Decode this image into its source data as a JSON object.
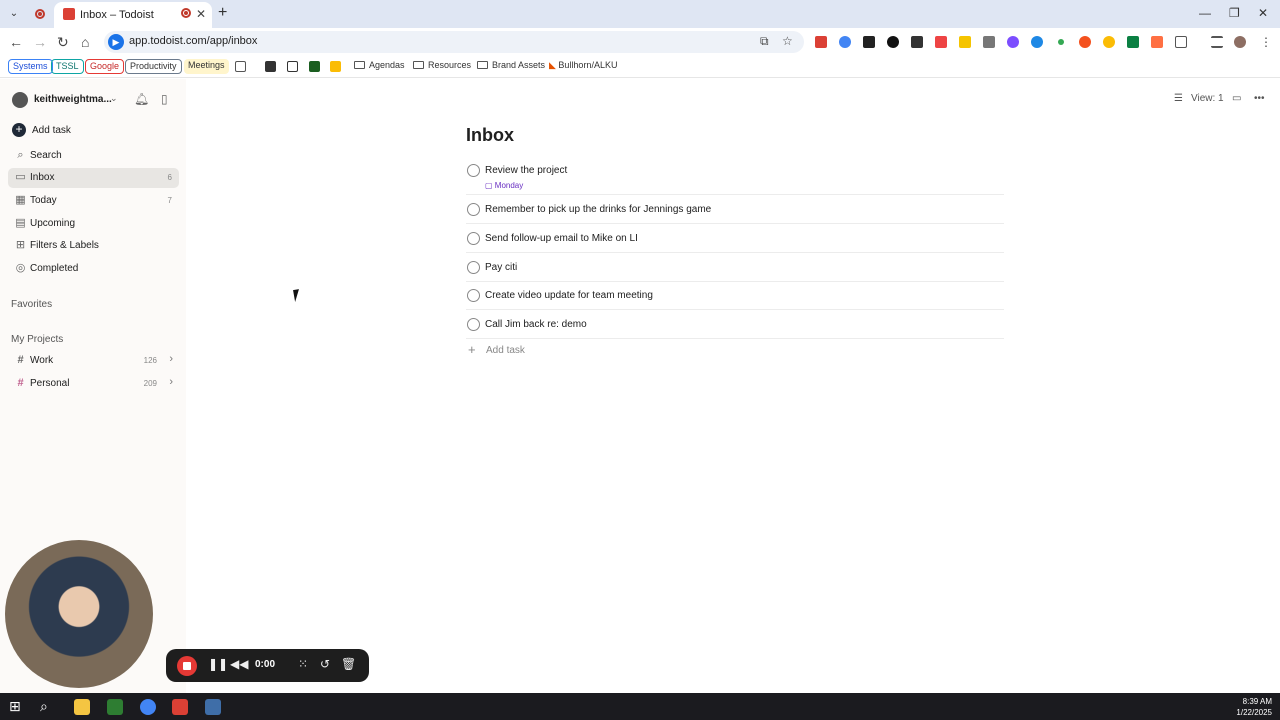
{
  "browser": {
    "tab_title": "Inbox – Todoist",
    "url": "app.todoist.com/app/inbox",
    "bookmarks": [
      "Systems",
      "TSSL",
      "Google",
      "Productivity",
      "Meetings",
      "Agendas",
      "Resources",
      "Brand Assets",
      "Bullhorn/ALKU"
    ]
  },
  "sidebar": {
    "user": "keithweightma...",
    "add_task": "Add task",
    "nav": [
      {
        "label": "Search",
        "count": ""
      },
      {
        "label": "Inbox",
        "count": "6"
      },
      {
        "label": "Today",
        "count": "7"
      },
      {
        "label": "Upcoming",
        "count": ""
      },
      {
        "label": "Filters & Labels",
        "count": ""
      },
      {
        "label": "Completed",
        "count": ""
      }
    ],
    "favorites_heading": "Favorites",
    "projects_heading": "My Projects",
    "projects": [
      {
        "label": "Work",
        "count": "126"
      },
      {
        "label": "Personal",
        "count": "209"
      }
    ]
  },
  "main": {
    "view_label": "View: 1",
    "title": "Inbox",
    "tasks": [
      {
        "text": "Review the project",
        "due": "Monday"
      },
      {
        "text": "Remember to pick up the drinks for Jennings game",
        "due": ""
      },
      {
        "text": "Send follow-up email to Mike on LI",
        "due": ""
      },
      {
        "text": "Pay citi",
        "due": ""
      },
      {
        "text": "Create video update for team meeting",
        "due": ""
      },
      {
        "text": "Call Jim back re: demo",
        "due": ""
      }
    ],
    "add_task": "Add task"
  },
  "recorder": {
    "time": "0:00"
  },
  "taskbar": {
    "time": "8:39 AM",
    "date": "1/22/2025"
  },
  "colors": {
    "accent": "#db4035",
    "due": "#692fc2",
    "sidebar_bg": "#fcfaf8"
  }
}
